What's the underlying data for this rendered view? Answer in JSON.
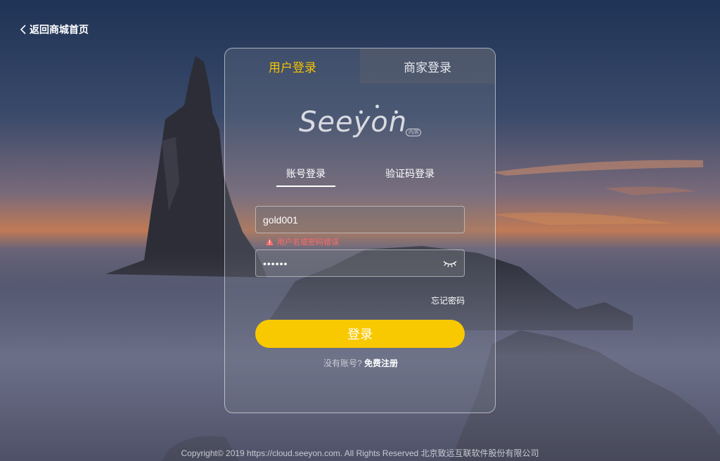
{
  "header": {
    "back_label": "返回商城首页"
  },
  "tabs": {
    "user_login": "用户登录",
    "merchant_login": "商家登录"
  },
  "logo": {
    "text": "Seeyon",
    "badge": "内测"
  },
  "sub_tabs": {
    "account": "账号登录",
    "sms": "验证码登录"
  },
  "form": {
    "username_value": "gold001",
    "error_text": "用户名或密码错误",
    "password_mask": "••••••",
    "forgot_label": "忘记密码",
    "login_label": "登录",
    "register_prompt": "没有账号?",
    "register_link": "免费注册"
  },
  "footer": {
    "copyright": "Copyright© 2019 https://cloud.seeyon.com. All Rights Reserved 北京致远互联软件股份有限公司"
  },
  "colors": {
    "accent": "#f8c800",
    "error": "#ff6b6b"
  },
  "icons": [
    "chevron-left-icon",
    "warning-icon",
    "eye-closed-icon"
  ]
}
